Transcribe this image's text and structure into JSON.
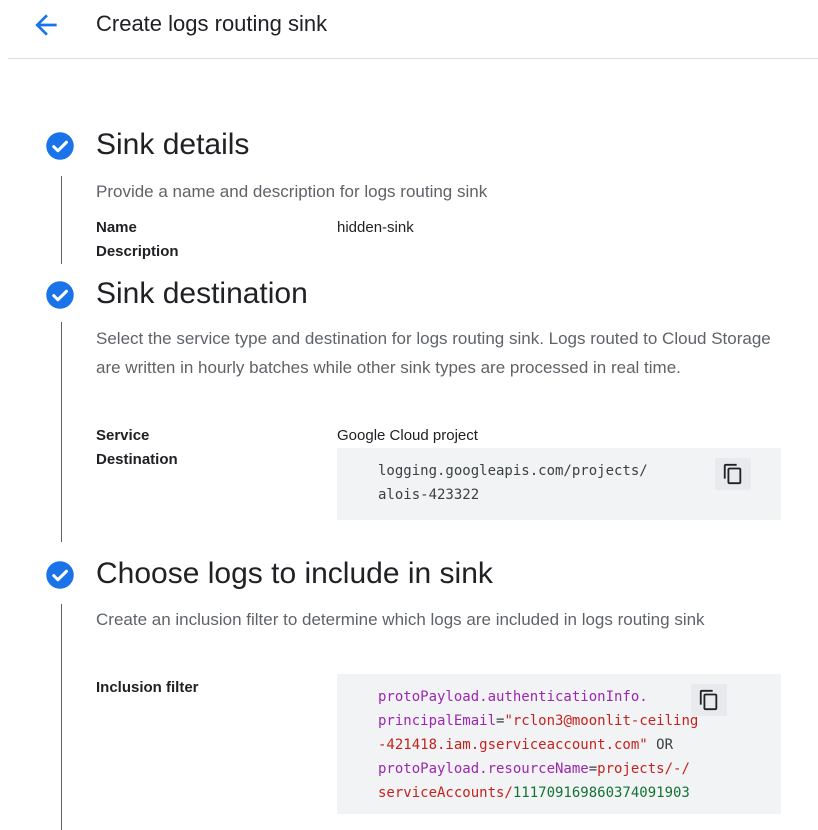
{
  "header": {
    "title": "Create logs routing sink"
  },
  "sections": [
    {
      "title": "Sink details",
      "description": "Provide a name and description for logs routing sink",
      "fields": [
        {
          "label": "Name",
          "value": "hidden-sink"
        },
        {
          "label": "Description",
          "value": ""
        }
      ]
    },
    {
      "title": "Sink destination",
      "description": "Select the service type and destination for logs routing sink. Logs routed to Cloud Storage are written in hourly batches while other sink types are processed in real time.",
      "fields": [
        {
          "label": "Service",
          "value": "Google Cloud project"
        },
        {
          "label": "Destination",
          "code_lines": [
            "logging.googleapis.com/projects/",
            "alois-423322"
          ]
        }
      ]
    },
    {
      "title": "Choose logs to include in sink",
      "description": "Create an inclusion filter to determine which logs are included in logs routing sink",
      "fields": [
        {
          "label": "Inclusion filter",
          "code": {
            "l1_key": "protoPayload.authenticationInfo.",
            "l2_key": "principalEmail",
            "l2_eq": "=",
            "l2_str": "\"rclon3@moonlit-ceiling",
            "l3_str": "-421418.iam.gserviceaccount.com\"",
            "l3_op": " OR",
            "l4_key": "protoPayload.resourceName",
            "l4_eq": "=",
            "l4_val": "projects/-/",
            "l5_val": "serviceAccounts/",
            "l5_num": "111709169860374091903"
          }
        }
      ]
    }
  ],
  "icons": {
    "back": "arrow-back-icon",
    "check": "check-circle-icon",
    "copy": "copy-icon"
  },
  "colors": {
    "accent": "#1a73e8",
    "keyword": "#9c27b0",
    "string": "#c5221f",
    "number": "#137333"
  }
}
